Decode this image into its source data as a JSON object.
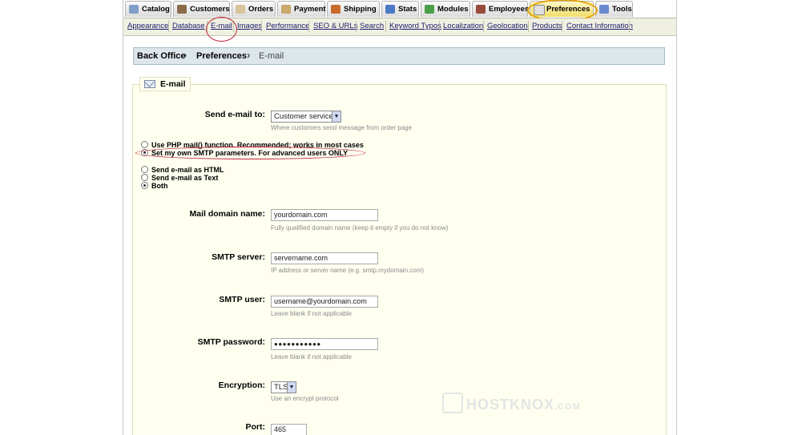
{
  "tabs": [
    {
      "label": "Catalog",
      "icon": "catalog-icon",
      "color": "#7f9fc8"
    },
    {
      "label": "Customers",
      "icon": "customers-icon",
      "color": "#8b6a4a"
    },
    {
      "label": "Orders",
      "icon": "orders-icon",
      "color": "#d9c39a"
    },
    {
      "label": "Payment",
      "icon": "payment-icon",
      "color": "#c8a96b"
    },
    {
      "label": "Shipping",
      "icon": "shipping-icon",
      "color": "#c86b2a"
    },
    {
      "label": "Stats",
      "icon": "stats-icon",
      "color": "#4a79c8"
    },
    {
      "label": "Modules",
      "icon": "modules-icon",
      "color": "#4aa04a"
    },
    {
      "label": "Employees",
      "icon": "employees-icon",
      "color": "#9a4a3a"
    },
    {
      "label": "Preferences",
      "icon": "preferences-icon",
      "color": "#e0e0e0"
    },
    {
      "label": "Tools",
      "icon": "tools-icon",
      "color": "#6a8ad0"
    }
  ],
  "submenu": [
    "Appearance",
    "Database",
    "E-mail",
    "Images",
    "Performance",
    "SEO & URLs",
    "Search",
    "Keyword Typos",
    "Localization",
    "Geolocation",
    "Products",
    "Contact Information"
  ],
  "breadcrumb": [
    "Back Office",
    "Preferences",
    "E-mail"
  ],
  "legend": "E-mail",
  "send_to": {
    "label": "Send e-mail to:",
    "value": "Customer service",
    "hint": "Where customers send message from order page"
  },
  "mail_method": [
    {
      "label": "Use PHP mail() function. Recommended; works in most cases",
      "checked": false
    },
    {
      "label": "Set my own SMTP parameters. For advanced users ONLY",
      "checked": true
    }
  ],
  "mail_type": [
    {
      "label": "Send e-mail as HTML",
      "checked": false
    },
    {
      "label": "Send e-mail as Text",
      "checked": false
    },
    {
      "label": "Both",
      "checked": true
    }
  ],
  "domain": {
    "label": "Mail domain name:",
    "value": "yourdomain.com",
    "hint": "Fully qualified domain name (keep it empty if you do not know)"
  },
  "server": {
    "label": "SMTP server:",
    "value": "servername.com",
    "hint": "IP address or server name (e.g. smtp.mydomain.com)"
  },
  "user": {
    "label": "SMTP user:",
    "value": "username@yourdomain.com",
    "hint": "Leave blank if not applicable"
  },
  "password": {
    "label": "SMTP password:",
    "value": "●●●●●●●●●●●",
    "hint": "Leave blank if not applicable"
  },
  "encryption": {
    "label": "Encryption:",
    "value": "TLS",
    "hint": "Use an encrypt protocol"
  },
  "port": {
    "label": "Port:",
    "value": "465"
  },
  "watermark": {
    "main": "HOSTKNOX",
    "suffix": ".COM"
  },
  "colors": {
    "active_tab": "#f2dd6a",
    "annotation": "#c0273c",
    "fieldset_bg": "#fffff0"
  }
}
